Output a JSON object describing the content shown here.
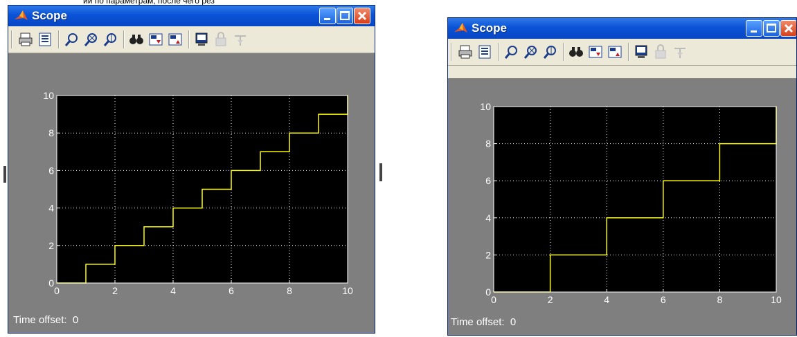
{
  "background_caption": "ии по параметрам, после чего рез",
  "windows": [
    {
      "title": "Scope",
      "time_offset_label": "Time offset:",
      "time_offset_value": "0",
      "icons": [
        "print-icon",
        "parameters-icon",
        "zoom-icon",
        "zoom-x-icon",
        "zoom-y-icon",
        "autoscale-icon",
        "save-axes-icon",
        "restore-axes-icon",
        "floating-scope-icon",
        "lock-axes-icon",
        "signal-selector-icon"
      ]
    },
    {
      "title": "Scope",
      "time_offset_label": "Time offset:",
      "time_offset_value": "0",
      "icons": [
        "print-icon",
        "parameters-icon",
        "zoom-icon",
        "zoom-x-icon",
        "zoom-y-icon",
        "autoscale-icon",
        "save-axes-icon",
        "restore-axes-icon",
        "floating-scope-icon",
        "lock-axes-icon",
        "signal-selector-icon"
      ]
    }
  ],
  "colors": {
    "plot_background": "#000000",
    "signal": "#ffff00",
    "grid": "#ffffff",
    "panel": "#7f7f7f",
    "title_bar": "#0a53d8"
  },
  "chart_data": [
    {
      "type": "line",
      "step": true,
      "x": [
        0,
        1,
        2,
        3,
        4,
        5,
        6,
        7,
        8,
        9,
        10
      ],
      "y": [
        0,
        1,
        2,
        3,
        4,
        5,
        6,
        7,
        8,
        9,
        10
      ],
      "xlim": [
        0,
        10
      ],
      "ylim": [
        0,
        10
      ],
      "xticks": [
        "0",
        "2",
        "4",
        "6",
        "8",
        "10"
      ],
      "yticks": [
        "0",
        "2",
        "4",
        "6",
        "8",
        "10"
      ],
      "grid": true
    },
    {
      "type": "line",
      "step": true,
      "x": [
        0,
        2,
        4,
        6,
        8,
        10
      ],
      "y": [
        0,
        2,
        4,
        6,
        8,
        10
      ],
      "xlim": [
        0,
        10
      ],
      "ylim": [
        0,
        10
      ],
      "xticks": [
        "0",
        "2",
        "4",
        "6",
        "8",
        "10"
      ],
      "yticks": [
        "0",
        "2",
        "4",
        "6",
        "8",
        "10"
      ],
      "grid": true
    }
  ]
}
